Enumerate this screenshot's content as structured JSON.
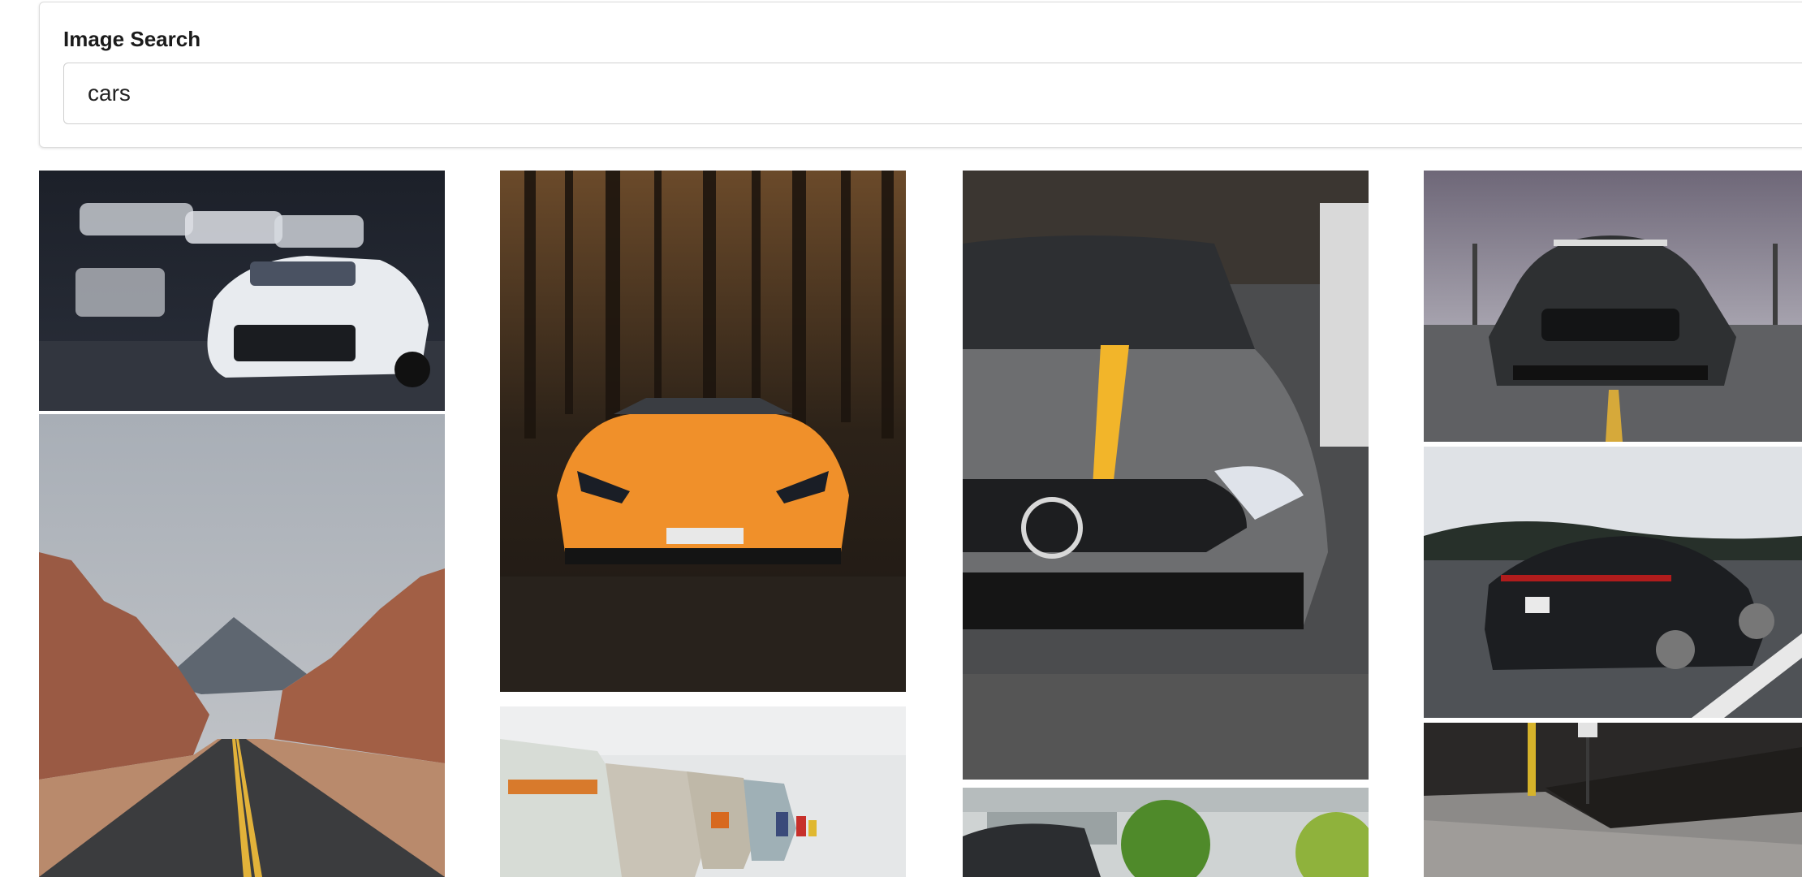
{
  "search": {
    "title": "Image Search",
    "query": "cars"
  },
  "results": [
    {
      "icon": "white-camaro-garage-image"
    },
    {
      "icon": "desert-road-image"
    },
    {
      "icon": "orange-lamborghini-forest-image"
    },
    {
      "icon": "vintage-bmw-row-image"
    },
    {
      "icon": "grey-mercedes-amg-image"
    },
    {
      "icon": "trees-building-car-image"
    },
    {
      "icon": "black-mustang-parking-image"
    },
    {
      "icon": "black-porsche-road-image"
    },
    {
      "icon": "parking-curb-image"
    }
  ],
  "colors": {
    "card_border": "#dcdcdc",
    "input_border": "#cfcfcf",
    "lamborghini": "#f0902a",
    "mercedes_stripe": "#f2b52a"
  }
}
